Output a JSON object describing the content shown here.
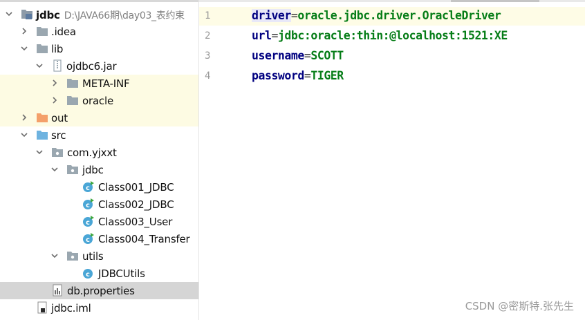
{
  "project_tree": {
    "root": {
      "name": "jdbc",
      "path": "D:\\JAVA66期\\day03_表约束"
    },
    "items": [
      {
        "label": "jdbc",
        "icon": "project-folder-icon"
      },
      {
        "label": ".idea",
        "icon": "folder-icon"
      },
      {
        "label": "lib",
        "icon": "folder-icon"
      },
      {
        "label": "ojdbc6.jar",
        "icon": "jar-icon"
      },
      {
        "label": "META-INF",
        "icon": "folder-icon"
      },
      {
        "label": "oracle",
        "icon": "folder-icon"
      },
      {
        "label": "out",
        "icon": "excluded-folder-icon"
      },
      {
        "label": "src",
        "icon": "source-folder-icon"
      },
      {
        "label": "com.yjxxt",
        "icon": "package-icon"
      },
      {
        "label": "jdbc",
        "icon": "package-icon"
      },
      {
        "label": "Class001_JDBC",
        "icon": "java-class-icon"
      },
      {
        "label": "Class002_JDBC",
        "icon": "java-class-icon"
      },
      {
        "label": "Class003_User",
        "icon": "java-class-icon"
      },
      {
        "label": "Class004_Transfer",
        "icon": "java-class-icon"
      },
      {
        "label": "utils",
        "icon": "package-icon"
      },
      {
        "label": "JDBCUtils",
        "icon": "java-class-icon"
      },
      {
        "label": "db.properties",
        "icon": "properties-file-icon"
      },
      {
        "label": "jdbc.iml",
        "icon": "iml-file-icon"
      }
    ]
  },
  "editor": {
    "lines": [
      {
        "number": "1",
        "key": "driver",
        "eq": "=",
        "value": "oracle.jdbc.driver.OracleDriver"
      },
      {
        "number": "2",
        "key": "url",
        "eq": "=",
        "value": "jdbc:oracle:thin:@localhost:1521:XE"
      },
      {
        "number": "3",
        "key": "username",
        "eq": "=",
        "value": "SCOTT"
      },
      {
        "number": "4",
        "key": "password",
        "eq": "=",
        "value": "TIGER"
      }
    ]
  },
  "watermark": "CSDN @密斯特.张先生",
  "colors": {
    "key": "#000080",
    "value": "#067d17",
    "selected_row": "#d5d5d5",
    "library_highlight": "#fdfbe3",
    "current_line": "#fefce6"
  }
}
